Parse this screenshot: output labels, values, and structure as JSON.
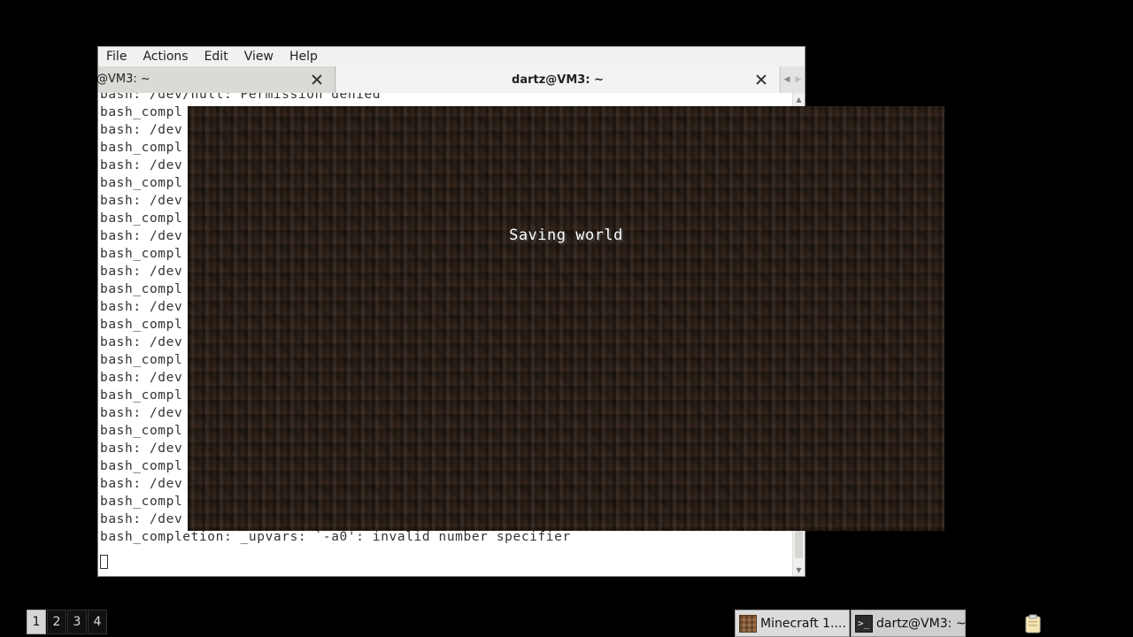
{
  "terminal": {
    "menu": [
      "File",
      "Actions",
      "Edit",
      "View",
      "Help"
    ],
    "tabs": [
      {
        "label": "@VM3: ~",
        "active": false
      },
      {
        "label": "dartz@VM3: ~",
        "active": true
      }
    ],
    "lines": [
      "bash: /dev/null: Permission denied",
      "bash_compl",
      "bash: /dev",
      "bash_compl",
      "bash: /dev",
      "bash_compl",
      "bash: /dev",
      "bash_compl",
      "bash: /dev",
      "bash_compl",
      "bash: /dev",
      "bash_compl",
      "bash: /dev",
      "bash_compl",
      "bash: /dev",
      "bash_compl",
      "bash: /dev",
      "bash_compl",
      "bash: /dev",
      "bash_compl",
      "bash: /dev",
      "bash_compl",
      "bash: /dev",
      "bash_compl",
      "bash: /dev",
      "bash_completion: _upvars: `-a0': invalid number specifier"
    ]
  },
  "minecraft": {
    "status": "Saving world"
  },
  "panel": {
    "workspaces": [
      "1",
      "2",
      "3",
      "4"
    ],
    "active_workspace": "1",
    "tasks": [
      {
        "label": "Minecraft 1....",
        "icon": "minecraft-icon"
      },
      {
        "label": "dartz@VM3: ~",
        "icon": "terminal-icon"
      }
    ]
  }
}
